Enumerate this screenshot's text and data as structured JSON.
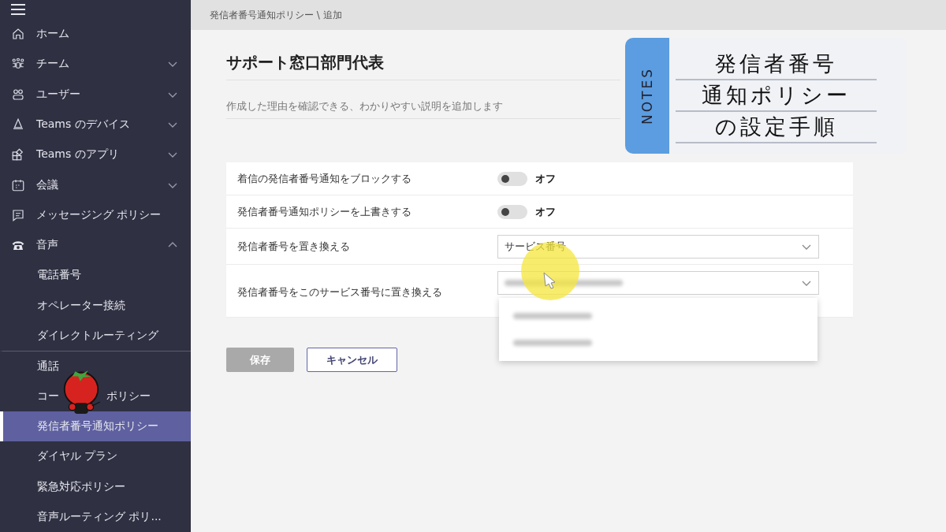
{
  "sidebar": {
    "items": [
      {
        "label": "ホーム",
        "kind": "link"
      },
      {
        "label": "チーム",
        "kind": "group",
        "expanded": false
      },
      {
        "label": "ユーザー",
        "kind": "group",
        "expanded": false
      },
      {
        "label": "Teams のデバイス",
        "kind": "group",
        "expanded": false
      },
      {
        "label": "Teams のアプリ",
        "kind": "group",
        "expanded": false
      },
      {
        "label": "会議",
        "kind": "group",
        "expanded": false
      },
      {
        "label": "メッセージング ポリシー",
        "kind": "link"
      },
      {
        "label": "音声",
        "kind": "group",
        "expanded": true,
        "children": [
          {
            "label": "電話番号",
            "selected": false
          },
          {
            "label": "オペレーター接続",
            "selected": false
          },
          {
            "label": "ダイレクトルーティング",
            "selected": false
          },
          {
            "label": "通話",
            "selected": false
          },
          {
            "parts": [
              "コー",
              "ポリシー"
            ],
            "selected": false
          },
          {
            "label": "発信者番号通知ポリシー",
            "selected": true
          },
          {
            "label": "ダイヤル プラン",
            "selected": false
          },
          {
            "label": "緊急対応ポリシー",
            "selected": false
          },
          {
            "label": "音声ルーティング ポリ...",
            "selected": false
          }
        ]
      }
    ]
  },
  "breadcrumb": "発信者番号通知ポリシー \\ 追加",
  "title": "サポート窓口部門代表",
  "description_placeholder": "作成した理由を確認できる、わかりやすい説明を追加します",
  "settings": [
    {
      "label": "着信の発信者番号通知をブロックする",
      "kind": "toggle",
      "on": false,
      "state_text": "オフ"
    },
    {
      "label": "発信者番号通知ポリシーを上書きする",
      "kind": "toggle",
      "on": false,
      "state_text": "オフ"
    },
    {
      "label": "発信者番号を置き換える",
      "kind": "select",
      "value": "サービス番号",
      "blurred": false,
      "open": false
    },
    {
      "label": "発信者番号をこのサービス番号に置き換える",
      "kind": "select",
      "blurred": true,
      "open": true,
      "options": [
        {
          "kind": "blurred"
        },
        {
          "kind": "blurred"
        }
      ]
    }
  ],
  "buttons": [
    {
      "label": "保存",
      "kind": "primary",
      "disabled": true
    },
    {
      "label": "キャンセル",
      "kind": "secondary",
      "disabled": false
    }
  ],
  "notes_card": {
    "tab_label": "NOTES",
    "lines": [
      "発信者番号",
      "通知ポリシー",
      "の設定手順"
    ]
  }
}
